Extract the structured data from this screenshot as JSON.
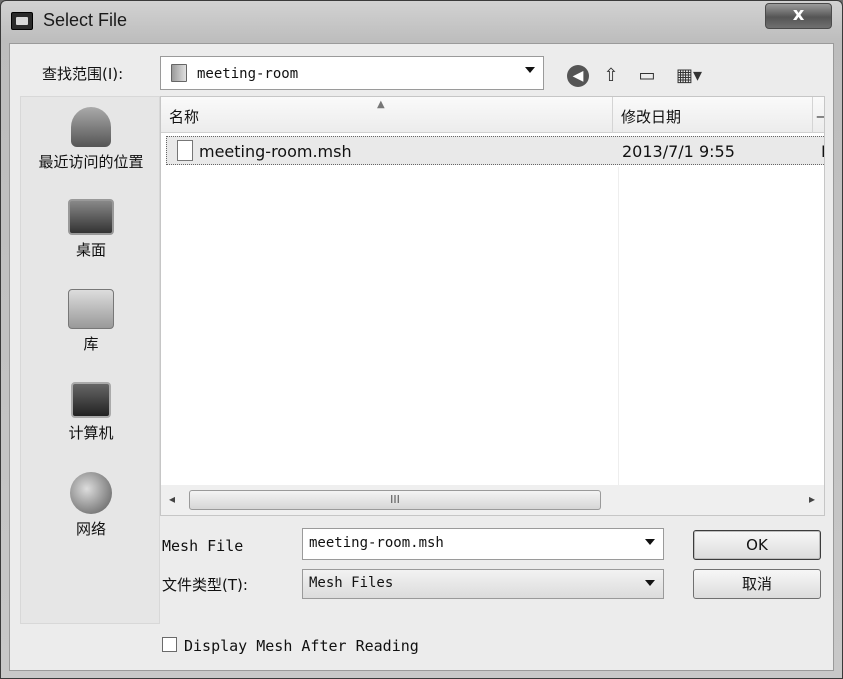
{
  "window": {
    "title": "Select File",
    "close": "x"
  },
  "lookin": {
    "label": "查找范围(I):",
    "value": "meeting-room"
  },
  "toolbar": {
    "back": "◀",
    "up": "⇧",
    "new_folder": "▭",
    "view": "▦▾"
  },
  "places": [
    {
      "label": "最近访问的位置",
      "icon": "recent-places-icon"
    },
    {
      "label": "桌面",
      "icon": "desktop-icon"
    },
    {
      "label": "库",
      "icon": "library-icon"
    },
    {
      "label": "计算机",
      "icon": "computer-icon"
    },
    {
      "label": "网络",
      "icon": "network-icon"
    }
  ],
  "list": {
    "columns": [
      "名称",
      "修改日期",
      "ᅳ"
    ],
    "rows": [
      {
        "name": "meeting-room.msh",
        "date": "2013/7/1 9:55",
        "extra": "I"
      }
    ],
    "scroll_mid": "III",
    "scroll_left": "◂",
    "scroll_right": "▸"
  },
  "filename": {
    "label": "Mesh File",
    "value": "meeting-room.msh"
  },
  "filetype": {
    "label": "文件类型(T):",
    "value": "Mesh Files"
  },
  "buttons": {
    "ok": "OK",
    "cancel": "取消"
  },
  "option": {
    "label": "Display Mesh After Reading",
    "checked": false
  }
}
